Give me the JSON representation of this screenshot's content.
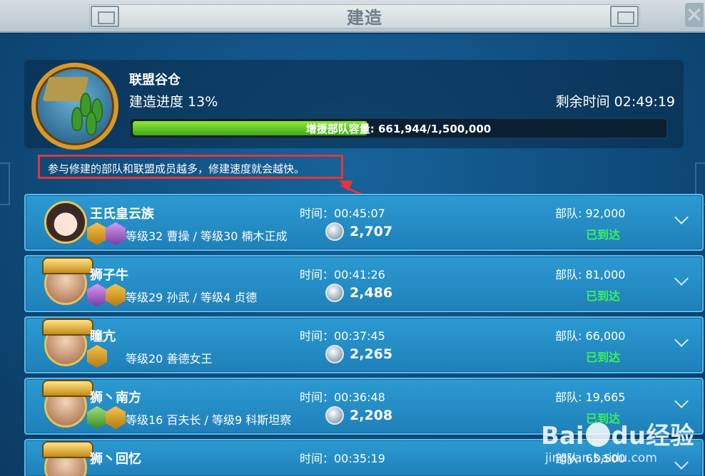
{
  "window": {
    "title": "建造",
    "close_icon": "close-icon"
  },
  "building": {
    "name": "联盟谷仓",
    "progress_text": "建造进度 13%",
    "time_left": "剩余时间 02:49:19",
    "capacity_text": "增援部队容量: 661,944/1,500,000",
    "capacity_fraction": 0.441
  },
  "tip": "参与修建的部队和联盟成员越多，修建速度就会越快。",
  "rows": [
    {
      "name": "王氏皇云族",
      "levels": "等级32 曹操 / 等级30 楠木正成",
      "time": "时间：00:45:07",
      "amount": "2,707",
      "troops": "部队: 92,000",
      "status": "已到达"
    },
    {
      "name": "狮子牛",
      "levels": "等级29 孙武 / 等级4 贞德",
      "time": "时间：00:41:26",
      "amount": "2,486",
      "troops": "部队: 81,000",
      "status": "已到达"
    },
    {
      "name": "瞳亢",
      "levels": "等级20 善德女王",
      "time": "时间：00:37:45",
      "amount": "2,265",
      "troops": "部队: 66,000",
      "status": "已到达"
    },
    {
      "name": "狮丶南方",
      "levels": "等级16 百夫长 / 等级9 科斯坦察",
      "time": "时间：00:36:48",
      "amount": "2,208",
      "troops": "部队: 19,665",
      "status": "已到达"
    },
    {
      "name": "狮丶回忆",
      "levels": "",
      "time": "时间：00:35:19",
      "amount": "",
      "troops": "部队: 65,500",
      "status": ""
    }
  ],
  "watermark": {
    "brand": "Bai",
    "brand2": "du",
    "brand_cn": "经验",
    "url": "jingyan.baidu.com"
  },
  "colors": {
    "accent_green": "#3cf05a",
    "highlight_red": "#e8343a",
    "row_blue": "#2c9ad2"
  }
}
